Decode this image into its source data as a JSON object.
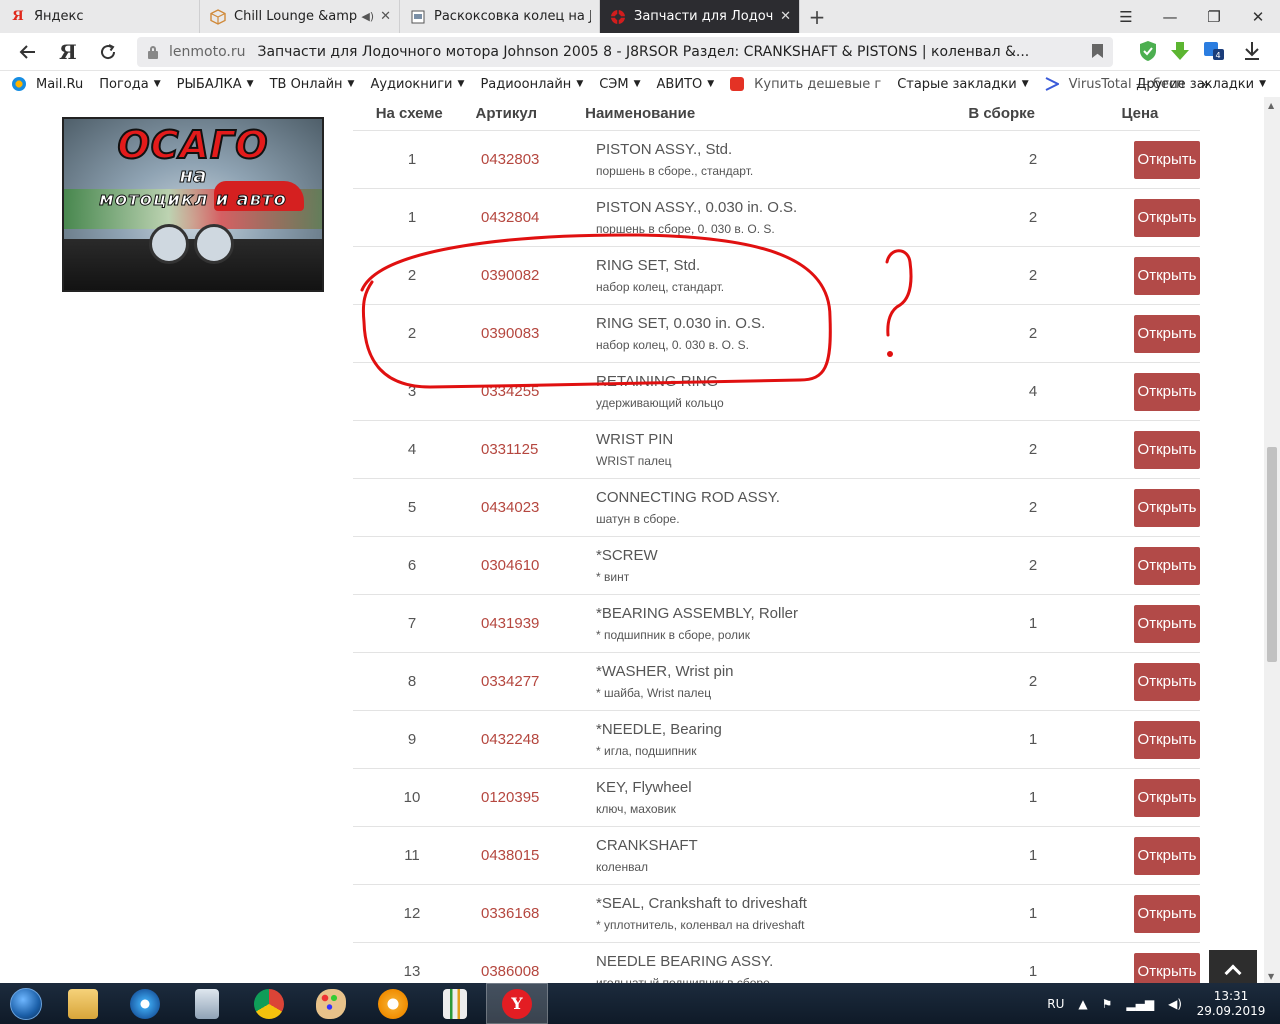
{
  "tabs": [
    {
      "title": "Яндекс",
      "icon": "yandex-icon",
      "active": false
    },
    {
      "title": "Chill Lounge &amp; S",
      "icon": "cube-icon",
      "active": false,
      "audio": true
    },
    {
      "title": "Раскоксовка колец на John",
      "icon": "page-icon",
      "active": false
    },
    {
      "title": "Запчасти для Лодочног",
      "icon": "lenmoto-icon",
      "active": true
    }
  ],
  "address": {
    "domain": "lenmoto.ru",
    "title": "Запчасти для Лодочного мотора Johnson 2005 8 - J8RSOR Раздел: CRANKSHAFT & PISTONS | коленвал &..."
  },
  "bookmarks": [
    {
      "label": "Mail.Ru",
      "icon": "mailru-icon",
      "caret": false
    },
    {
      "label": "Погода",
      "caret": true
    },
    {
      "label": "РЫБАЛКА",
      "caret": true
    },
    {
      "label": "ТВ Онлайн",
      "caret": true
    },
    {
      "label": "Аудиокниги",
      "caret": true
    },
    {
      "label": "Радиоонлайн",
      "caret": true
    },
    {
      "label": "СЭМ",
      "caret": true
    },
    {
      "label": "АВИТО",
      "caret": true
    },
    {
      "label": "Купить дешевые г",
      "icon": "aliexpress-icon",
      "caret": false
    },
    {
      "label": "Старые закладки",
      "caret": true
    },
    {
      "label": "VirusTotal — бесп",
      "icon": "virustotal-icon",
      "caret": false
    }
  ],
  "bookmarks_other": "Другие закладки",
  "ad": {
    "line1": "ОСАГО",
    "line2": "на",
    "line3": "мотоцикл и авто"
  },
  "table": {
    "headers": {
      "num": "На схеме",
      "article": "Артикул",
      "name": "Наименование",
      "qty": "В сборке",
      "price": "Цена"
    },
    "button_label": "Открыть",
    "rows": [
      {
        "num": "1",
        "article": "0432803",
        "en": "PISTON ASSY., Std.",
        "ru": "поршень в сборе., стандарт.",
        "qty": "2"
      },
      {
        "num": "1",
        "article": "0432804",
        "en": "PISTON ASSY., 0.030 in. O.S.",
        "ru": "поршень в сборе, 0. 030 в. O. S.",
        "qty": "2"
      },
      {
        "num": "2",
        "article": "0390082",
        "en": "RING SET, Std.",
        "ru": "набор колец, стандарт.",
        "qty": "2"
      },
      {
        "num": "2",
        "article": "0390083",
        "en": "RING SET, 0.030 in. O.S.",
        "ru": "набор колец, 0. 030 в. O. S.",
        "qty": "2"
      },
      {
        "num": "3",
        "article": "0334255",
        "en": "RETAINING RING",
        "ru": "удерживающий кольцо",
        "qty": "4"
      },
      {
        "num": "4",
        "article": "0331125",
        "en": "WRIST PIN",
        "ru": "WRIST палец",
        "qty": "2"
      },
      {
        "num": "5",
        "article": "0434023",
        "en": "CONNECTING ROD ASSY.",
        "ru": "шатун в сборе.",
        "qty": "2"
      },
      {
        "num": "6",
        "article": "0304610",
        "en": "*SCREW",
        "ru": "* винт",
        "qty": "2"
      },
      {
        "num": "7",
        "article": "0431939",
        "en": "*BEARING ASSEMBLY, Roller",
        "ru": "* подшипник в сборе, ролик",
        "qty": "1"
      },
      {
        "num": "8",
        "article": "0334277",
        "en": "*WASHER, Wrist pin",
        "ru": "* шайба, Wrist палец",
        "qty": "2"
      },
      {
        "num": "9",
        "article": "0432248",
        "en": "*NEEDLE, Bearing",
        "ru": "* игла, подшипник",
        "qty": "1"
      },
      {
        "num": "10",
        "article": "0120395",
        "en": "KEY, Flywheel",
        "ru": "ключ, маховик",
        "qty": "1"
      },
      {
        "num": "11",
        "article": "0438015",
        "en": "CRANKSHAFT",
        "ru": "коленвал",
        "qty": "1"
      },
      {
        "num": "12",
        "article": "0336168",
        "en": "*SEAL, Crankshaft to driveshaft",
        "ru": "* уплотнитель, коленвал на driveshaft",
        "qty": "1"
      },
      {
        "num": "13",
        "article": "0386008",
        "en": "NEEDLE BEARING ASSY.",
        "ru": "игольчатый подшипник в сборе",
        "qty": "1"
      }
    ]
  },
  "colors": {
    "accent_button": "#b24a48",
    "article_link": "#b5473f",
    "annotation": "#e01010"
  },
  "taskbar": {
    "apps": [
      "explorer-icon",
      "compass-icon",
      "calculator-icon",
      "chrome-icon",
      "paint-icon",
      "vpn-icon",
      "taskmanager-icon",
      "yandex-browser-icon"
    ],
    "lang": "RU",
    "time": "13:31",
    "date": "29.09.2019"
  }
}
